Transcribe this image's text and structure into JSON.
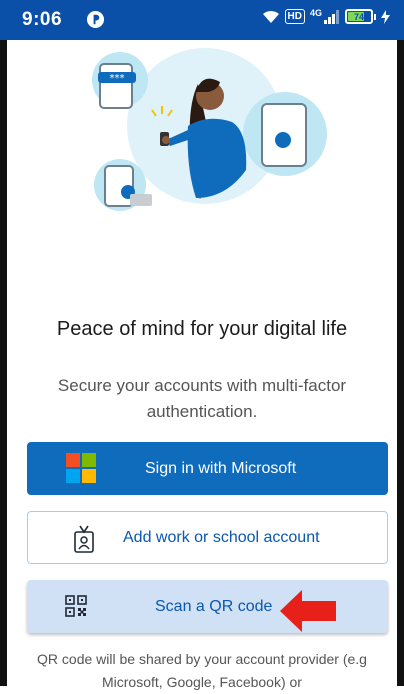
{
  "status_bar": {
    "time": "9:06",
    "hd": "HD",
    "network": "4G",
    "battery": "74",
    "battery_level": 0.74
  },
  "onboarding": {
    "headline": "Peace of mind for your digital life",
    "subtext": "Secure your accounts with multi-factor authentication.",
    "sign_in_label": "Sign in with Microsoft",
    "add_account_label": "Add work or school account",
    "scan_qr_label": "Scan a QR code",
    "footer_text": "QR code will be shared by your account provider (e.g Microsoft, Google, Facebook) or"
  },
  "colors": {
    "status_bar": "#0a4fa8",
    "primary_button": "#0f6cbd",
    "link_text": "#0a58b0",
    "highlight_button": "#d0e0f5",
    "annotation_arrow": "#e8201a",
    "ms_logo": [
      "#f25022",
      "#7fba00",
      "#00a4ef",
      "#ffb900"
    ]
  },
  "icons": {
    "status_left": "app-notification-icon",
    "wifi": "wifi-icon",
    "signal": "signal-icon",
    "charging": "charging-bolt-icon",
    "sign_in": "microsoft-logo-icon",
    "work_account": "id-badge-icon",
    "scan": "qr-code-icon",
    "annotation": "red-arrow-icon"
  }
}
